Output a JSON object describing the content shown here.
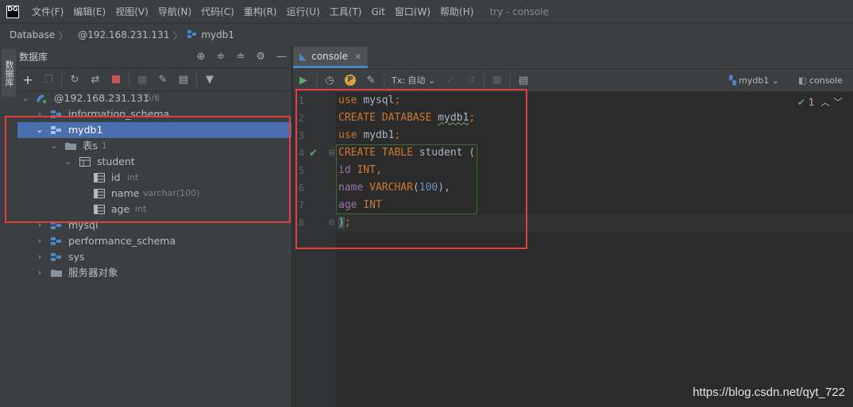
{
  "menubar": {
    "logo": "DG",
    "items": [
      "文件(F)",
      "编辑(E)",
      "视图(V)",
      "导航(N)",
      "代码(C)",
      "重构(R)",
      "运行(U)",
      "工具(T)",
      "Git",
      "窗口(W)",
      "帮助(H)"
    ],
    "window_title": "try - console"
  },
  "breadcrumb": {
    "items": [
      "Database",
      "@192.168.231.131",
      "mydb1"
    ]
  },
  "left_strip": {
    "tab_label": "数据库"
  },
  "db_panel": {
    "title": "数据库",
    "tree": [
      {
        "label": "@192.168.231.131",
        "meta": "5/6"
      },
      {
        "label": "information_schema"
      },
      {
        "label": "mydb1"
      },
      {
        "label": "表s",
        "meta": "1"
      },
      {
        "label": "student"
      },
      {
        "label": "id",
        "meta": "int"
      },
      {
        "label": "name",
        "meta": "varchar(100)"
      },
      {
        "label": "age",
        "meta": "int"
      },
      {
        "label": "mysql"
      },
      {
        "label": "performance_schema"
      },
      {
        "label": "sys"
      },
      {
        "label": "服务器对象"
      }
    ]
  },
  "editor": {
    "tab_label": "console",
    "tx_label": "Tx: 自动",
    "schema_selector": "mydb1",
    "session_selector": "console",
    "inspection_count": "1",
    "line_numbers": [
      "1",
      "2",
      "3",
      "4",
      "5",
      "6",
      "7",
      "8"
    ]
  },
  "watermark": "https://blog.csdn.net/qyt_722",
  "colors": {
    "selection": "#4b6eaf",
    "highlight_box": "#e0403e",
    "keyword": "#cc7832",
    "identifier": "#a9b7c6",
    "number": "#6897bb"
  }
}
